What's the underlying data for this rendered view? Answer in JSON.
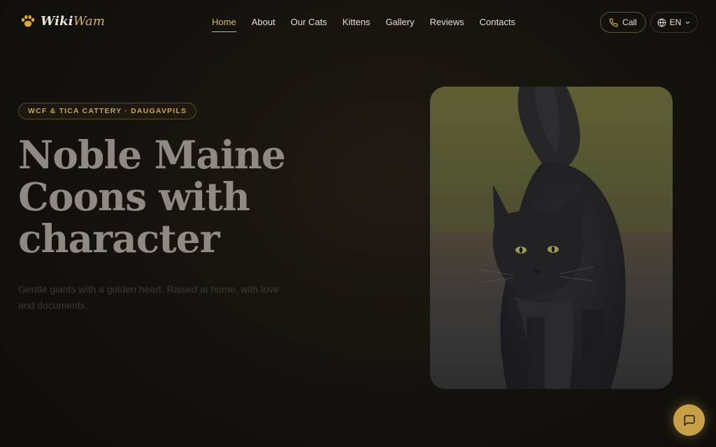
{
  "brand": {
    "name_main": "Wiki",
    "name_accent": "Wam",
    "logo_icon": "paw-icon"
  },
  "nav": {
    "items": [
      {
        "label": "Home",
        "active": true
      },
      {
        "label": "About"
      },
      {
        "label": "Our Cats"
      },
      {
        "label": "Kittens"
      },
      {
        "label": "Gallery"
      },
      {
        "label": "Reviews"
      },
      {
        "label": "Contacts"
      }
    ]
  },
  "actions": {
    "call_label": "Call",
    "call_icon": "phone-icon",
    "lang_label": "EN",
    "lang_icon": "globe-icon"
  },
  "hero": {
    "badge": "WCF & TICA CATTERY · DAUGAVPILS",
    "title_lines": [
      "Noble Maine",
      "Coons with",
      "character"
    ],
    "subtitle_lines": [
      "Gentle giants with a golden heart. Raised at home, with love",
      "and documents."
    ]
  },
  "chat": {
    "icon": "chat-bubble-icon"
  },
  "colors": {
    "accent": "#d8b25c",
    "background": "#15120d",
    "chat_button": "#c79f46"
  }
}
